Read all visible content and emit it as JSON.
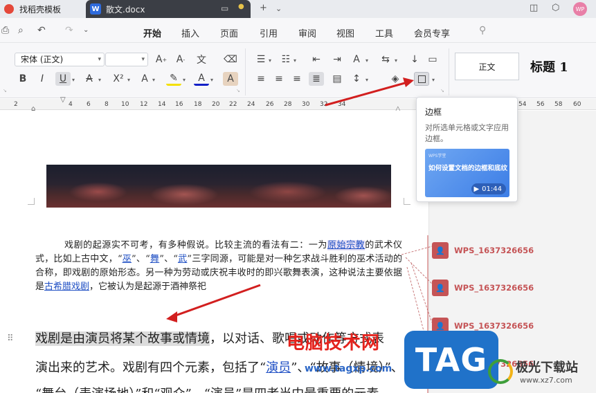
{
  "tabs": [
    {
      "label": "找稻壳模板",
      "icon": "wps-logo-icon"
    },
    {
      "label": "散文.docx",
      "icon": "word-doc-icon",
      "badge": "W"
    }
  ],
  "tabbar": {
    "new_tab": "+",
    "dropdown": "⌄",
    "user": "WP"
  },
  "menus": [
    "开始",
    "插入",
    "页面",
    "引用",
    "审阅",
    "视图",
    "工具",
    "会员专享"
  ],
  "active_menu": "开始",
  "font": {
    "name": "宋体 (正文)",
    "size": ""
  },
  "styles": {
    "normal": "正文",
    "heading1": "标题 1"
  },
  "ruler_numbers": [
    "2",
    "4",
    "6",
    "8",
    "10",
    "12",
    "14",
    "16",
    "18",
    "20",
    "22",
    "24",
    "26",
    "28",
    "30",
    "32",
    "34",
    "54",
    "56",
    "58",
    "60"
  ],
  "tooltip": {
    "title": "边框",
    "description": "对所选单元格或文字应用边框。",
    "video_brand": "WPS学堂",
    "video_title": "如何设置文档的边框和底纹",
    "video_duration": "01:44"
  },
  "doc": {
    "para1_a": "戏剧的起源实不可考，有多种假说。比较主流的看法有二：一为",
    "link_yszj": "原始宗教",
    "para1_b": "的武术仪式，比如上古中文，“",
    "link_wu1": "巫",
    "para1_c": "”、“",
    "link_wu2": "舞",
    "para1_d": "”、“",
    "link_wu3": "武",
    "para1_e": "”三字同源，可能是对一种乞求战斗胜利的巫术活动的合称，即戏剧的原始形态。另一种为劳动或庆祝丰收时的即兴歌舞表演，这种说法主要依据是",
    "link_gxl": "古希腊戏剧",
    "para1_f": "，它被认为是起源于酒神祭祀",
    "big1_hl": "戏剧是由演员将某个故事或情境",
    "big1_rest": "，以对话、歌唱或动作等方式表",
    "big2": "演出来的艺术。戏剧有四个元素，包括了“",
    "big2_link": "演员",
    "big2_rest": "”、“故事（情境）”、",
    "big3": "“舞台（表演场地）”和“观众”。“演员”是四者当中最重要的元素"
  },
  "comments": [
    {
      "user": "WPS_1637326656"
    },
    {
      "user": "WPS_1637326656"
    },
    {
      "user": "WPS_1637326656"
    },
    {
      "user": "WPS_1637326656"
    }
  ],
  "watermarks": {
    "site_cn": "电脑技术网",
    "site_url": "www.tagxp.com",
    "tag": "TAG",
    "xz_name": "极光下载站",
    "xz_url": "www.xz7.com"
  },
  "colors": {
    "accent": "#3a6ff0",
    "comment": "#c55456",
    "arrow": "#d21f1f"
  }
}
